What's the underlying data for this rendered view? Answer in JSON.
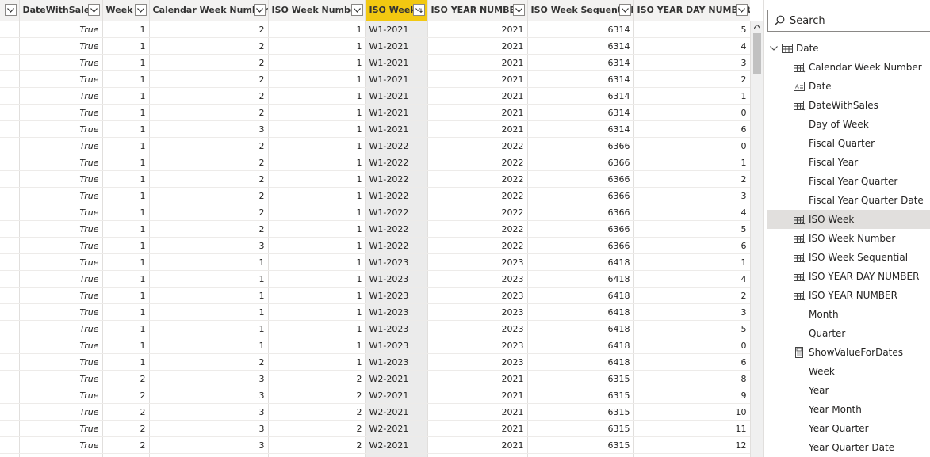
{
  "grid": {
    "columns": [
      {
        "label": "",
        "align": "txt"
      },
      {
        "label": "DateWithSales",
        "align": "bool"
      },
      {
        "label": "Week",
        "align": "num"
      },
      {
        "label": "Calendar Week Number",
        "align": "num"
      },
      {
        "label": "ISO Week Number",
        "align": "num"
      },
      {
        "label": "ISO Week",
        "align": "txt",
        "selected": true
      },
      {
        "label": "ISO YEAR NUMBER",
        "align": "num"
      },
      {
        "label": "ISO Week Sequential",
        "align": "num"
      },
      {
        "label": "ISO YEAR DAY NUMBER",
        "align": "num"
      }
    ],
    "rows": [
      [
        "",
        "True",
        "1",
        "2",
        "1",
        "W1-2021",
        "2021",
        "6314",
        "5"
      ],
      [
        "",
        "True",
        "1",
        "2",
        "1",
        "W1-2021",
        "2021",
        "6314",
        "4"
      ],
      [
        "",
        "True",
        "1",
        "2",
        "1",
        "W1-2021",
        "2021",
        "6314",
        "3"
      ],
      [
        "",
        "True",
        "1",
        "2",
        "1",
        "W1-2021",
        "2021",
        "6314",
        "2"
      ],
      [
        "",
        "True",
        "1",
        "2",
        "1",
        "W1-2021",
        "2021",
        "6314",
        "1"
      ],
      [
        "",
        "True",
        "1",
        "2",
        "1",
        "W1-2021",
        "2021",
        "6314",
        "0"
      ],
      [
        "",
        "True",
        "1",
        "3",
        "1",
        "W1-2021",
        "2021",
        "6314",
        "6"
      ],
      [
        "",
        "True",
        "1",
        "2",
        "1",
        "W1-2022",
        "2022",
        "6366",
        "0"
      ],
      [
        "",
        "True",
        "1",
        "2",
        "1",
        "W1-2022",
        "2022",
        "6366",
        "1"
      ],
      [
        "",
        "True",
        "1",
        "2",
        "1",
        "W1-2022",
        "2022",
        "6366",
        "2"
      ],
      [
        "",
        "True",
        "1",
        "2",
        "1",
        "W1-2022",
        "2022",
        "6366",
        "3"
      ],
      [
        "",
        "True",
        "1",
        "2",
        "1",
        "W1-2022",
        "2022",
        "6366",
        "4"
      ],
      [
        "",
        "True",
        "1",
        "2",
        "1",
        "W1-2022",
        "2022",
        "6366",
        "5"
      ],
      [
        "",
        "True",
        "1",
        "3",
        "1",
        "W1-2022",
        "2022",
        "6366",
        "6"
      ],
      [
        "",
        "True",
        "1",
        "1",
        "1",
        "W1-2023",
        "2023",
        "6418",
        "1"
      ],
      [
        "",
        "True",
        "1",
        "1",
        "1",
        "W1-2023",
        "2023",
        "6418",
        "4"
      ],
      [
        "",
        "True",
        "1",
        "1",
        "1",
        "W1-2023",
        "2023",
        "6418",
        "2"
      ],
      [
        "",
        "True",
        "1",
        "1",
        "1",
        "W1-2023",
        "2023",
        "6418",
        "3"
      ],
      [
        "",
        "True",
        "1",
        "1",
        "1",
        "W1-2023",
        "2023",
        "6418",
        "5"
      ],
      [
        "",
        "True",
        "1",
        "1",
        "1",
        "W1-2023",
        "2023",
        "6418",
        "0"
      ],
      [
        "",
        "True",
        "1",
        "2",
        "1",
        "W1-2023",
        "2023",
        "6418",
        "6"
      ],
      [
        "",
        "True",
        "2",
        "3",
        "2",
        "W2-2021",
        "2021",
        "6315",
        "8"
      ],
      [
        "",
        "True",
        "2",
        "3",
        "2",
        "W2-2021",
        "2021",
        "6315",
        "9"
      ],
      [
        "",
        "True",
        "2",
        "3",
        "2",
        "W2-2021",
        "2021",
        "6315",
        "10"
      ],
      [
        "",
        "True",
        "2",
        "3",
        "2",
        "W2-2021",
        "2021",
        "6315",
        "11"
      ],
      [
        "",
        "True",
        "2",
        "3",
        "2",
        "W2-2021",
        "2021",
        "6315",
        "12"
      ],
      [
        "",
        "True",
        "2",
        "3",
        "2",
        "W2-2021",
        "2021",
        "6315",
        "13"
      ]
    ]
  },
  "fields_pane": {
    "search_placeholder": "Search",
    "table_name": "Date",
    "fields": [
      {
        "label": "Calendar Week Number",
        "icon": "calculated-column-icon"
      },
      {
        "label": "Date",
        "icon": "text-field-icon"
      },
      {
        "label": "DateWithSales",
        "icon": "calculated-column-icon"
      },
      {
        "label": "Day of Week",
        "icon": "none"
      },
      {
        "label": "Fiscal Quarter",
        "icon": "none"
      },
      {
        "label": "Fiscal Year",
        "icon": "none"
      },
      {
        "label": "Fiscal Year Quarter",
        "icon": "none"
      },
      {
        "label": "Fiscal Year Quarter Date",
        "icon": "none"
      },
      {
        "label": "ISO Week",
        "icon": "calculated-column-icon",
        "selected": true
      },
      {
        "label": "ISO Week Number",
        "icon": "calculated-column-icon"
      },
      {
        "label": "ISO Week Sequential",
        "icon": "calculated-column-icon"
      },
      {
        "label": "ISO YEAR DAY NUMBER",
        "icon": "calculated-column-icon"
      },
      {
        "label": "ISO YEAR NUMBER",
        "icon": "calculated-column-icon"
      },
      {
        "label": "Month",
        "icon": "none"
      },
      {
        "label": "Quarter",
        "icon": "none"
      },
      {
        "label": "ShowValueForDates",
        "icon": "measure-calculator-icon"
      },
      {
        "label": "Week",
        "icon": "none"
      },
      {
        "label": "Year",
        "icon": "none"
      },
      {
        "label": "Year Month",
        "icon": "none"
      },
      {
        "label": "Year Quarter",
        "icon": "none"
      },
      {
        "label": "Year Quarter Date",
        "icon": "none"
      }
    ]
  },
  "colors": {
    "selected_header": "#f2c811",
    "selected_column": "#ebebeb",
    "selected_field": "#e1dfdd"
  }
}
